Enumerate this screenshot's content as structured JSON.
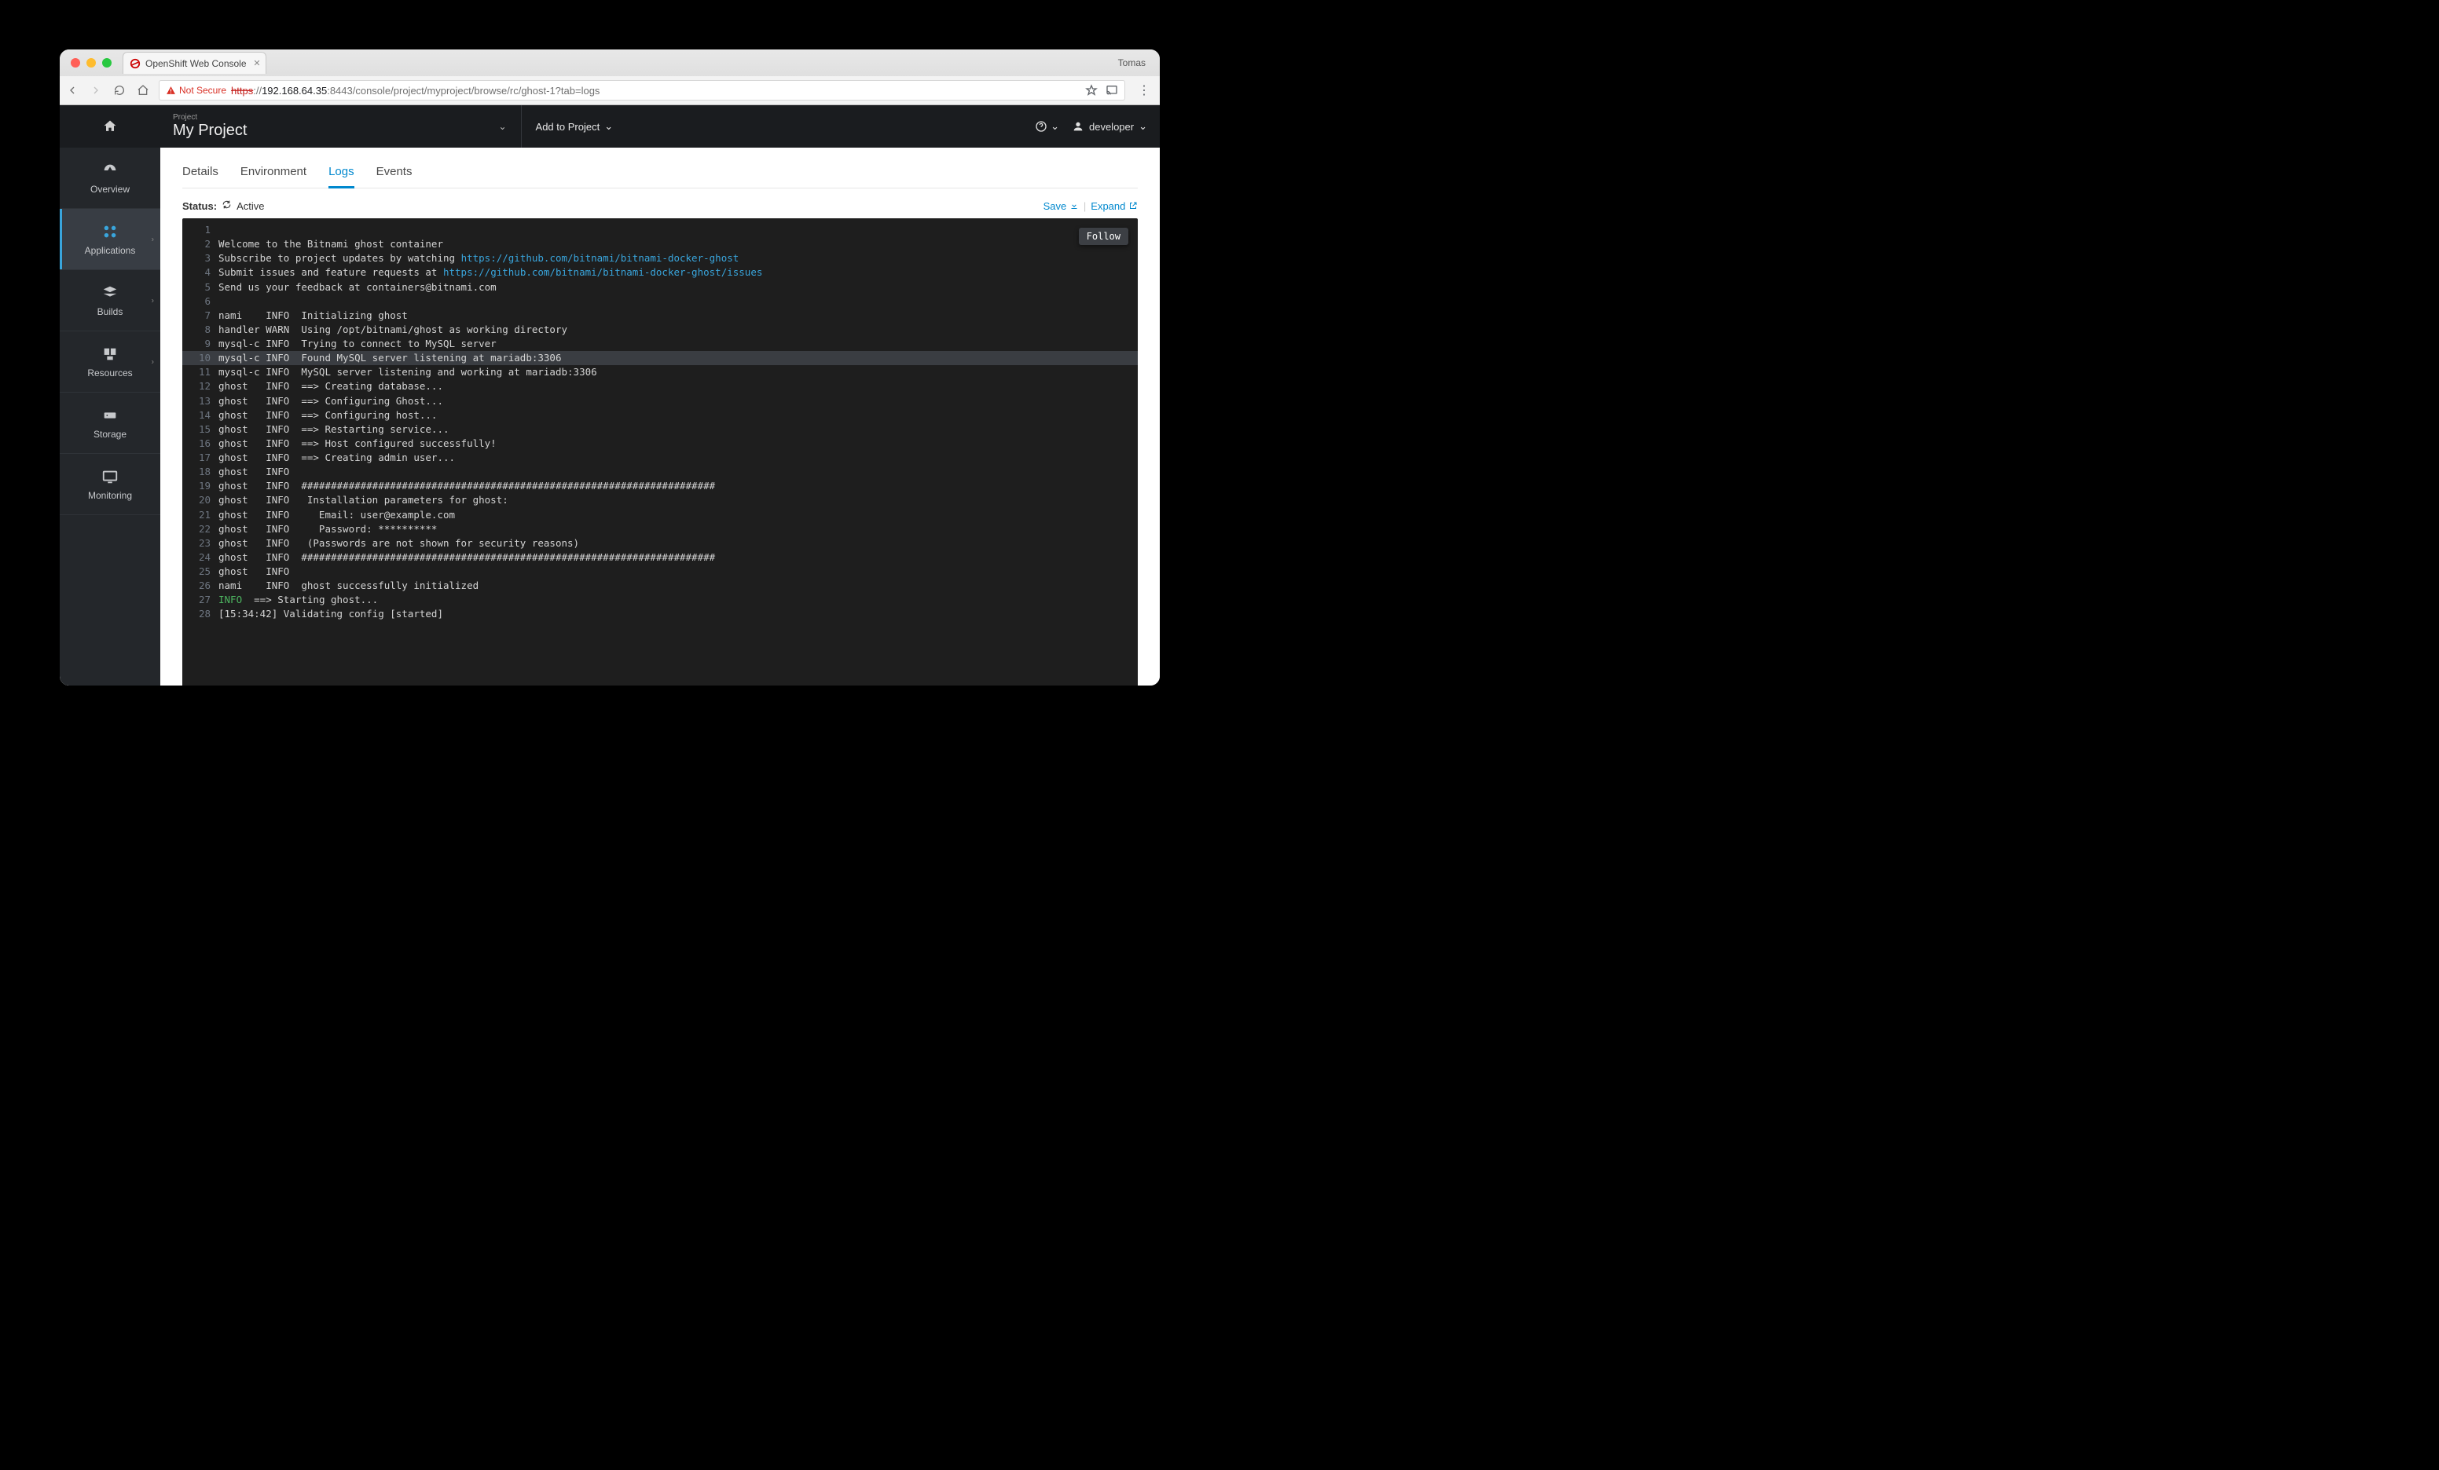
{
  "browser": {
    "tab_title": "OpenShift Web Console",
    "profile": "Tomas",
    "not_secure": "Not Secure",
    "url_scheme": "https",
    "url_host": "192.168.64.35",
    "url_port_path": ":8443/console/project/myproject/browse/rc/ghost-1?tab=logs"
  },
  "header": {
    "project_label": "Project",
    "project_name": "My Project",
    "add_to_project": "Add to Project",
    "user": "developer"
  },
  "sidebar": {
    "items": [
      {
        "label": "Overview"
      },
      {
        "label": "Applications"
      },
      {
        "label": "Builds"
      },
      {
        "label": "Resources"
      },
      {
        "label": "Storage"
      },
      {
        "label": "Monitoring"
      }
    ]
  },
  "tabs": {
    "details": "Details",
    "environment": "Environment",
    "logs": "Logs",
    "events": "Events"
  },
  "status": {
    "label": "Status:",
    "value": "Active",
    "save": "Save",
    "expand": "Expand",
    "follow": "Follow"
  },
  "logs": [
    {
      "n": 1,
      "t": ""
    },
    {
      "n": 2,
      "t": "Welcome to the Bitnami ghost container"
    },
    {
      "n": 3,
      "t": "Subscribe to project updates by watching ",
      "link": "https://github.com/bitnami/bitnami-docker-ghost"
    },
    {
      "n": 4,
      "t": "Submit issues and feature requests at ",
      "link": "https://github.com/bitnami/bitnami-docker-ghost/issues"
    },
    {
      "n": 5,
      "t": "Send us your feedback at containers@bitnami.com"
    },
    {
      "n": 6,
      "t": ""
    },
    {
      "n": 7,
      "t": "nami    INFO  Initializing ghost"
    },
    {
      "n": 8,
      "t": "handler WARN  Using /opt/bitnami/ghost as working directory"
    },
    {
      "n": 9,
      "t": "mysql-c INFO  Trying to connect to MySQL server"
    },
    {
      "n": 10,
      "t": "mysql-c INFO  Found MySQL server listening at mariadb:3306",
      "hl": true
    },
    {
      "n": 11,
      "t": "mysql-c INFO  MySQL server listening and working at mariadb:3306"
    },
    {
      "n": 12,
      "t": "ghost   INFO  ==> Creating database..."
    },
    {
      "n": 13,
      "t": "ghost   INFO  ==> Configuring Ghost..."
    },
    {
      "n": 14,
      "t": "ghost   INFO  ==> Configuring host..."
    },
    {
      "n": 15,
      "t": "ghost   INFO  ==> Restarting service..."
    },
    {
      "n": 16,
      "t": "ghost   INFO  ==> Host configured successfully!"
    },
    {
      "n": 17,
      "t": "ghost   INFO  ==> Creating admin user..."
    },
    {
      "n": 18,
      "t": "ghost   INFO"
    },
    {
      "n": 19,
      "t": "ghost   INFO  ######################################################################"
    },
    {
      "n": 20,
      "t": "ghost   INFO   Installation parameters for ghost:"
    },
    {
      "n": 21,
      "t": "ghost   INFO     Email: user@example.com"
    },
    {
      "n": 22,
      "t": "ghost   INFO     Password: **********"
    },
    {
      "n": 23,
      "t": "ghost   INFO   (Passwords are not shown for security reasons)"
    },
    {
      "n": 24,
      "t": "ghost   INFO  ######################################################################"
    },
    {
      "n": 25,
      "t": "ghost   INFO"
    },
    {
      "n": 26,
      "t": "nami    INFO  ghost successfully initialized"
    },
    {
      "n": 27,
      "green": "INFO",
      "t2": "  ==> Starting ghost..."
    },
    {
      "n": 28,
      "t": "[15:34:42] Validating config [started]"
    }
  ]
}
